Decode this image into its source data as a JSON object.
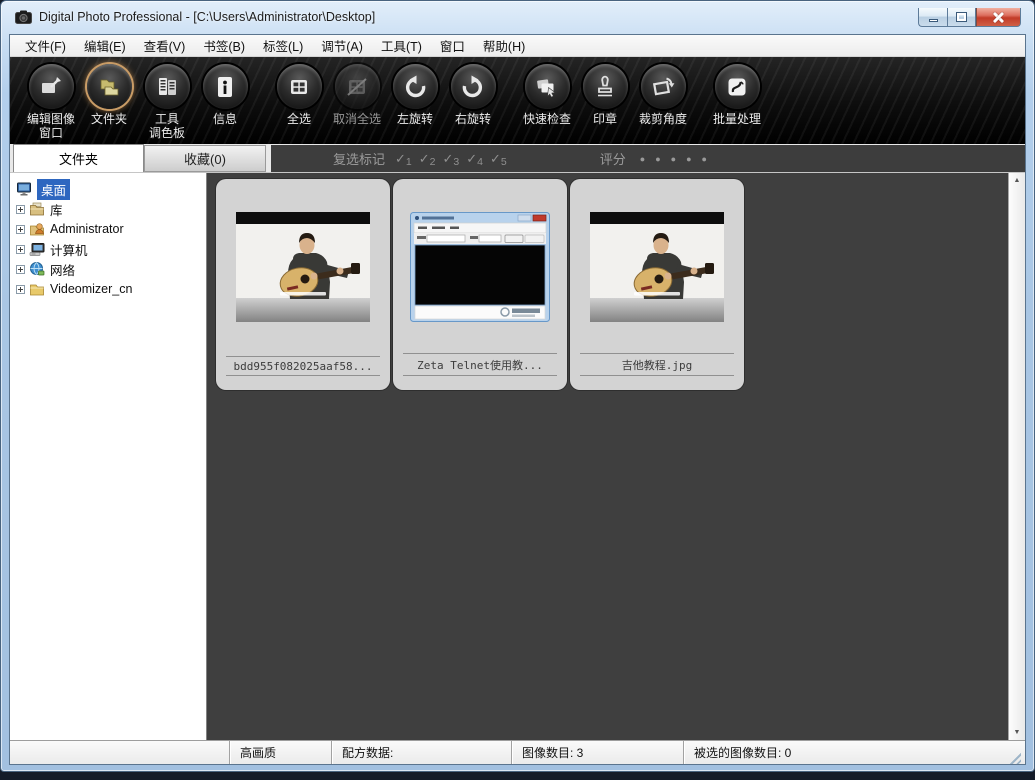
{
  "titlebar": {
    "title": "Digital Photo Professional - [C:\\Users\\Administrator\\Desktop]"
  },
  "menu": {
    "items": [
      "文件(F)",
      "编辑(E)",
      "查看(V)",
      "书签(B)",
      "标签(L)",
      "调节(A)",
      "工具(T)",
      "窗口",
      "帮助(H)"
    ]
  },
  "toolbar": {
    "buttons": [
      {
        "label": "编辑图像\n窗口",
        "icon": "edit-image-window-icon"
      },
      {
        "label": "文件夹",
        "icon": "folder-icon",
        "active": true
      },
      {
        "label": "工具\n调色板",
        "icon": "tool-palette-icon"
      },
      {
        "label": "信息",
        "icon": "info-icon"
      },
      {
        "label": "全选",
        "icon": "select-all-icon"
      },
      {
        "label": "取消全选",
        "icon": "deselect-all-icon",
        "disabled": true
      },
      {
        "label": "左旋转",
        "icon": "rotate-left-icon"
      },
      {
        "label": "右旋转",
        "icon": "rotate-right-icon"
      },
      {
        "label": "快速检查",
        "icon": "quick-check-icon"
      },
      {
        "label": "印章",
        "icon": "stamp-icon"
      },
      {
        "label": "裁剪角度",
        "icon": "trim-angle-icon"
      },
      {
        "label": "批量处理",
        "icon": "batch-process-icon"
      }
    ]
  },
  "tabs": {
    "folder_label": "文件夹",
    "favorites_label": "收藏(0)"
  },
  "markbar": {
    "checkmark_label": "复选标记",
    "check_glyph": "✓",
    "checks": [
      "1",
      "2",
      "3",
      "4",
      "5"
    ],
    "rating_label": "评分",
    "dot_glyph": "●",
    "rating_dots": 5
  },
  "tree": {
    "items": [
      {
        "label": "桌面",
        "icon": "desktop-icon",
        "selected": true
      },
      {
        "label": "库",
        "icon": "libraries-icon"
      },
      {
        "label": "Administrator",
        "icon": "user-folder-icon"
      },
      {
        "label": "计算机",
        "icon": "computer-icon"
      },
      {
        "label": "网络",
        "icon": "network-icon"
      },
      {
        "label": "Videomizer_cn",
        "icon": "yellow-folder-icon"
      }
    ]
  },
  "thumbnails": [
    {
      "filename": "bdd955f082025aaf58...",
      "content": "guitar-lesson-video-frame"
    },
    {
      "filename": "Zeta Telnet使用教...",
      "content": "zeta-telnet-window-screenshot"
    },
    {
      "filename": "吉他教程.jpg",
      "content": "guitar-lesson-video-frame"
    }
  ],
  "scrollbar": {
    "up": "▲",
    "down": "▼"
  },
  "statusbar": {
    "quality": "高画质",
    "recipe_label": "配方数据:",
    "image_count": "图像数目: 3",
    "selected_count": "被选的图像数目: 0"
  },
  "colors": {
    "accent_ring": "#c99c66",
    "tree_selection": "#2e67c0",
    "content_bg": "#3f3f3f",
    "close_button": "#c23b28"
  }
}
